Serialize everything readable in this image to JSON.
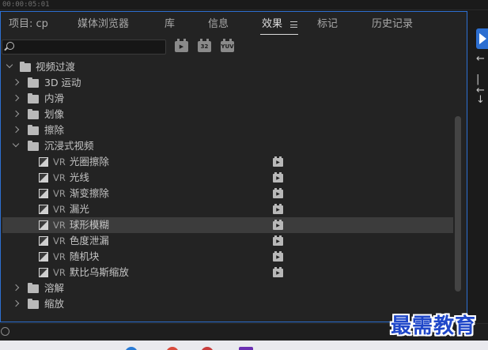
{
  "timecode": "00:00:05:01",
  "tabs": [
    {
      "label": "项目: cp",
      "active": false
    },
    {
      "label": "媒体浏览器",
      "active": false
    },
    {
      "label": "库",
      "active": false
    },
    {
      "label": "信息",
      "active": false
    },
    {
      "label": "效果",
      "active": true
    },
    {
      "label": "标记",
      "active": false
    },
    {
      "label": "历史记录",
      "active": false
    }
  ],
  "search": {
    "value": "",
    "placeholder": ""
  },
  "filter_buttons": [
    "accelerated-effects",
    "32",
    "YUV"
  ],
  "tree": {
    "root": "视频过渡",
    "categories": [
      {
        "label": "3D 运动",
        "expanded": false
      },
      {
        "label": "内滑",
        "expanded": false
      },
      {
        "label": "划像",
        "expanded": false
      },
      {
        "label": "擦除",
        "expanded": false
      },
      {
        "label": "沉浸式视频",
        "expanded": true
      }
    ],
    "immersive_items": [
      {
        "prefix": "VR",
        "label": "光圈擦除",
        "selected": false
      },
      {
        "prefix": "VR",
        "label": "光线",
        "selected": false
      },
      {
        "prefix": "VR",
        "label": "渐变擦除",
        "selected": false
      },
      {
        "prefix": "VR",
        "label": "漏光",
        "selected": false
      },
      {
        "prefix": "VR",
        "label": "球形模糊",
        "selected": true
      },
      {
        "prefix": "VR",
        "label": "色度泄漏",
        "selected": false
      },
      {
        "prefix": "VR",
        "label": "随机块",
        "selected": false
      },
      {
        "prefix": "VR",
        "label": "默比乌斯缩放",
        "selected": false
      }
    ],
    "after_categories": [
      {
        "label": "溶解",
        "expanded": false
      },
      {
        "label": "缩放",
        "expanded": false
      }
    ]
  },
  "watermark": "最需教育",
  "colors": {
    "accent": "#2d6fd1",
    "selected_row": "#3c3c3c",
    "panel_bg": "#232323",
    "watermark": "#1f47c9"
  }
}
